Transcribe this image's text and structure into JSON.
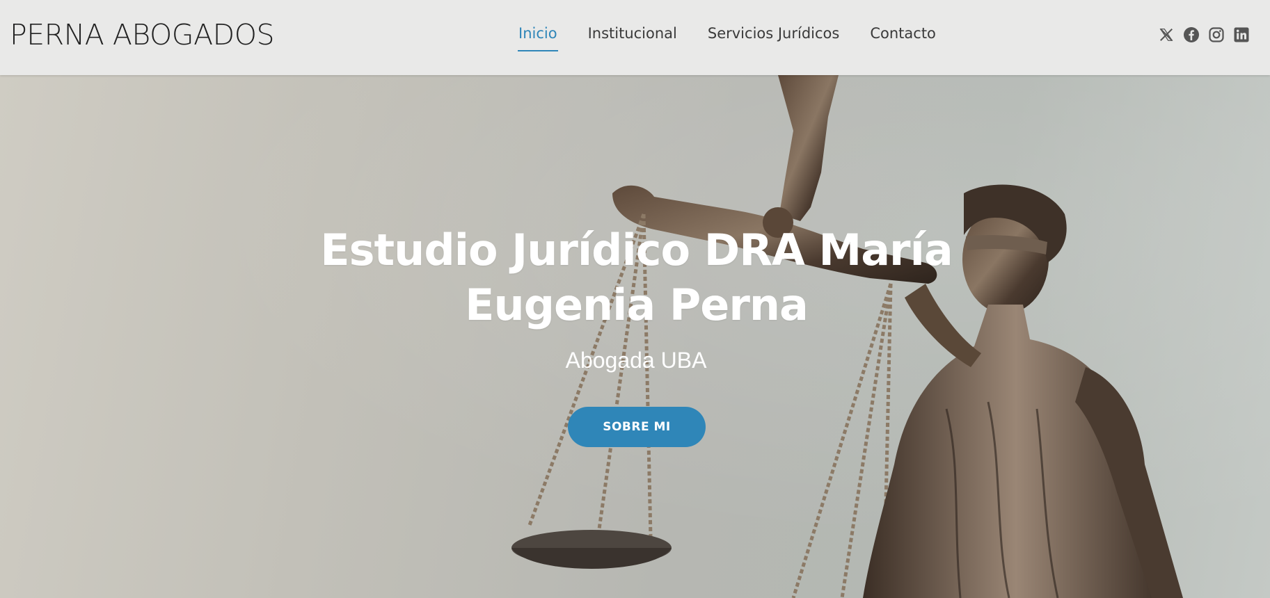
{
  "header": {
    "brand": "PERNA ABOGADOS",
    "nav": [
      {
        "label": "Inicio",
        "active": true
      },
      {
        "label": "Institucional",
        "active": false
      },
      {
        "label": "Servicios Jurídicos",
        "active": false
      },
      {
        "label": "Contacto",
        "active": false
      }
    ],
    "social": [
      "x-icon",
      "facebook-icon",
      "instagram-icon",
      "linkedin-icon"
    ]
  },
  "hero": {
    "title_line1": "Estudio Jurídico DRA María",
    "title_line2": "Eugenia Perna",
    "subtitle": "Abogada UBA",
    "button_label": "SOBRE MI"
  },
  "colors": {
    "accent": "#2f86b8",
    "header_bg": "#e9e9e8",
    "text_dark": "#222222",
    "icon_gray": "#555555"
  }
}
